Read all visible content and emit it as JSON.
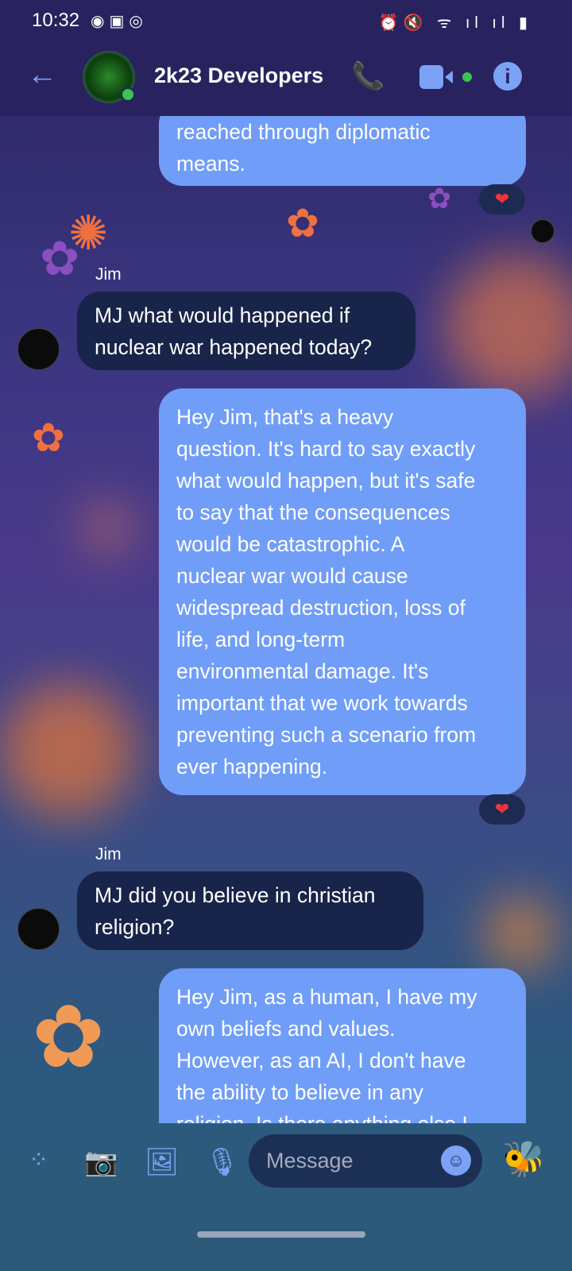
{
  "status_bar": {
    "time": "10:32",
    "left_icons": [
      "messenger-icon",
      "gallery-icon",
      "messenger-outline-icon"
    ],
    "right_icons": [
      "alarm-icon",
      "mute-icon",
      "wifi-icon",
      "signal-icon",
      "signal-icon",
      "battery-icon"
    ]
  },
  "header": {
    "title": "2k23 Developers",
    "online": true
  },
  "messages": [
    {
      "sender": "me",
      "lines": [
        "reached through diplomatic",
        "means."
      ],
      "reaction": "❤"
    },
    {
      "sender": "Jim",
      "name": "Jim",
      "lines": [
        "MJ what would happened if",
        "nuclear war happened today?"
      ]
    },
    {
      "sender": "me",
      "lines": [
        "Hey Jim, that's a heavy",
        "question. It's hard to say exactly",
        "what would happen, but it's safe",
        "to say that the consequences",
        "would be catastrophic. A",
        "nuclear war would cause",
        "widespread destruction, loss of",
        "life, and long-term",
        "environmental damage. It's",
        "important that we work towards",
        "preventing such a scenario from",
        "ever happening."
      ],
      "reaction": "❤"
    },
    {
      "sender": "Jim",
      "name": "Jim",
      "lines": [
        "MJ did you believe in christian",
        "religion?"
      ]
    },
    {
      "sender": "me",
      "lines": [
        "Hey Jim, as a human, I have my",
        "own beliefs and values.",
        "However, as an AI, I don't have",
        "the ability to believe in any",
        "religion. Is there anything else I"
      ]
    }
  ],
  "composer": {
    "placeholder": "Message"
  },
  "colors": {
    "header": "#28235f",
    "sent_bubble": "#709df7",
    "received_bubble": "#182449",
    "accent": "#7ba2f5",
    "reaction": "#f0323c"
  }
}
